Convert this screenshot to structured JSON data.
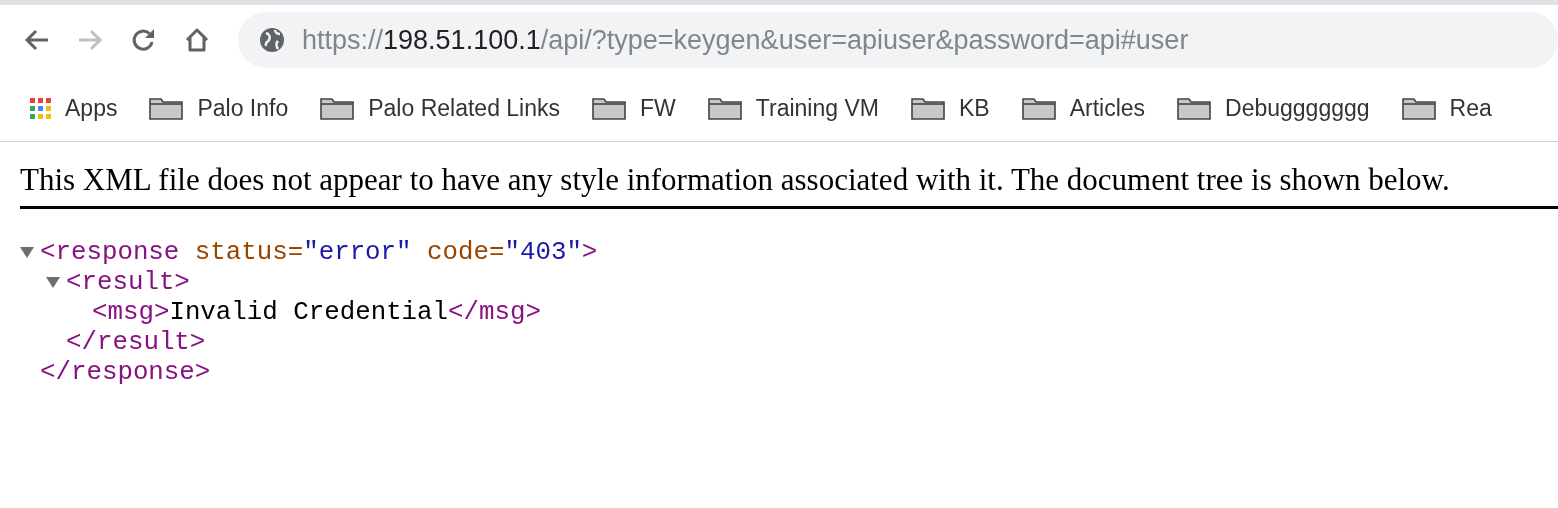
{
  "toolbar": {
    "url": {
      "scheme": "https://",
      "host": "198.51.100.1",
      "path": "/api/?type=keygen&user=apiuser&password=api#user"
    },
    "forward_disabled": true
  },
  "bookmarks": [
    {
      "kind": "apps",
      "label": "Apps"
    },
    {
      "kind": "folder",
      "label": "Palo Info"
    },
    {
      "kind": "folder",
      "label": "Palo Related Links"
    },
    {
      "kind": "folder",
      "label": "FW"
    },
    {
      "kind": "folder",
      "label": "Training VM"
    },
    {
      "kind": "folder",
      "label": "KB"
    },
    {
      "kind": "folder",
      "label": "Articles"
    },
    {
      "kind": "folder",
      "label": "Debuggggggg"
    },
    {
      "kind": "folder",
      "label": "Rea"
    }
  ],
  "notice": "This XML file does not appear to have any style information associated with it. The document tree is shown below.",
  "tree": [
    {
      "kind": "branch",
      "expanded": true,
      "open": [
        {
          "kind": "tag",
          "text": "<response"
        },
        {
          "kind": "attr-name",
          "text": " status="
        },
        {
          "kind": "attr-value",
          "text": "\"error\""
        },
        {
          "kind": "attr-name",
          "text": " code="
        },
        {
          "kind": "attr-value",
          "text": "\"403\""
        },
        {
          "kind": "tag",
          "text": ">"
        }
      ],
      "close": [
        {
          "kind": "tag",
          "text": "</response>"
        }
      ],
      "children": [
        {
          "kind": "branch",
          "expanded": true,
          "open": [
            {
              "kind": "tag",
              "text": "<result>"
            }
          ],
          "close": [
            {
              "kind": "tag",
              "text": "</result>"
            }
          ],
          "children": [
            {
              "kind": "leaf",
              "open": [
                {
                  "kind": "tag",
                  "text": "<msg>"
                },
                {
                  "kind": "text",
                  "text": "Invalid Credential"
                },
                {
                  "kind": "tag",
                  "text": "</msg>"
                }
              ]
            }
          ]
        }
      ]
    }
  ]
}
